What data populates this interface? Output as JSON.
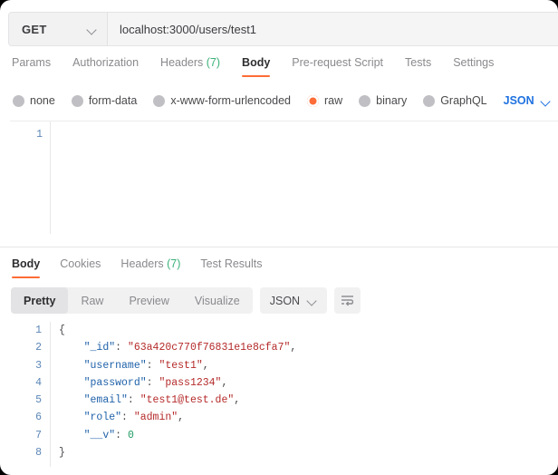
{
  "request": {
    "method": "GET",
    "url": "localhost:3000/users/test1",
    "tabs": [
      {
        "label": "Params",
        "count": "",
        "active": false
      },
      {
        "label": "Authorization",
        "count": "",
        "active": false
      },
      {
        "label": "Headers",
        "count": "(7)",
        "active": false
      },
      {
        "label": "Body",
        "count": "",
        "active": true
      },
      {
        "label": "Pre-request Script",
        "count": "",
        "active": false
      },
      {
        "label": "Tests",
        "count": "",
        "active": false
      },
      {
        "label": "Settings",
        "count": "",
        "active": false
      }
    ],
    "body_types": [
      {
        "label": "none",
        "selected": false
      },
      {
        "label": "form-data",
        "selected": false
      },
      {
        "label": "x-www-form-urlencoded",
        "selected": false
      },
      {
        "label": "raw",
        "selected": true
      },
      {
        "label": "binary",
        "selected": false
      },
      {
        "label": "GraphQL",
        "selected": false
      }
    ],
    "raw_format": "JSON",
    "editor": {
      "line_numbers": [
        "1"
      ],
      "content": ""
    }
  },
  "response": {
    "tabs": [
      {
        "label": "Body",
        "count": "",
        "active": true
      },
      {
        "label": "Cookies",
        "count": "",
        "active": false
      },
      {
        "label": "Headers",
        "count": "(7)",
        "active": false
      },
      {
        "label": "Test Results",
        "count": "",
        "active": false
      }
    ],
    "view_modes": [
      {
        "label": "Pretty",
        "active": true
      },
      {
        "label": "Raw",
        "active": false
      },
      {
        "label": "Preview",
        "active": false
      },
      {
        "label": "Visualize",
        "active": false
      }
    ],
    "format": "JSON",
    "wrap_icon": "word-wrap-icon",
    "body": {
      "line_numbers": [
        "1",
        "2",
        "3",
        "4",
        "5",
        "6",
        "7",
        "8"
      ],
      "lines": [
        {
          "indent": 0,
          "tokens": [
            {
              "t": "{",
              "c": "p"
            }
          ]
        },
        {
          "indent": 1,
          "tokens": [
            {
              "t": "\"_id\"",
              "c": "k"
            },
            {
              "t": ": ",
              "c": "p"
            },
            {
              "t": "\"63a420c770f76831e1e8cfa7\"",
              "c": "s"
            },
            {
              "t": ",",
              "c": "p"
            }
          ]
        },
        {
          "indent": 1,
          "tokens": [
            {
              "t": "\"username\"",
              "c": "k"
            },
            {
              "t": ": ",
              "c": "p"
            },
            {
              "t": "\"test1\"",
              "c": "s"
            },
            {
              "t": ",",
              "c": "p"
            }
          ]
        },
        {
          "indent": 1,
          "tokens": [
            {
              "t": "\"password\"",
              "c": "k"
            },
            {
              "t": ": ",
              "c": "p"
            },
            {
              "t": "\"pass1234\"",
              "c": "s"
            },
            {
              "t": ",",
              "c": "p"
            }
          ]
        },
        {
          "indent": 1,
          "tokens": [
            {
              "t": "\"email\"",
              "c": "k"
            },
            {
              "t": ": ",
              "c": "p"
            },
            {
              "t": "\"test1@test.de\"",
              "c": "s"
            },
            {
              "t": ",",
              "c": "p"
            }
          ]
        },
        {
          "indent": 1,
          "tokens": [
            {
              "t": "\"role\"",
              "c": "k"
            },
            {
              "t": ": ",
              "c": "p"
            },
            {
              "t": "\"admin\"",
              "c": "s"
            },
            {
              "t": ",",
              "c": "p"
            }
          ]
        },
        {
          "indent": 1,
          "tokens": [
            {
              "t": "\"__v\"",
              "c": "k"
            },
            {
              "t": ": ",
              "c": "p"
            },
            {
              "t": "0",
              "c": "n"
            }
          ]
        },
        {
          "indent": 0,
          "tokens": [
            {
              "t": "}",
              "c": "p"
            }
          ]
        }
      ]
    }
  },
  "colors": {
    "accent": "#ff6c37",
    "link": "#1f72e0",
    "count": "#3cb179",
    "json_key": "#1f61a9",
    "json_string": "#b52a2a",
    "json_number": "#1d9b63",
    "gutter": "#5b86b7"
  }
}
